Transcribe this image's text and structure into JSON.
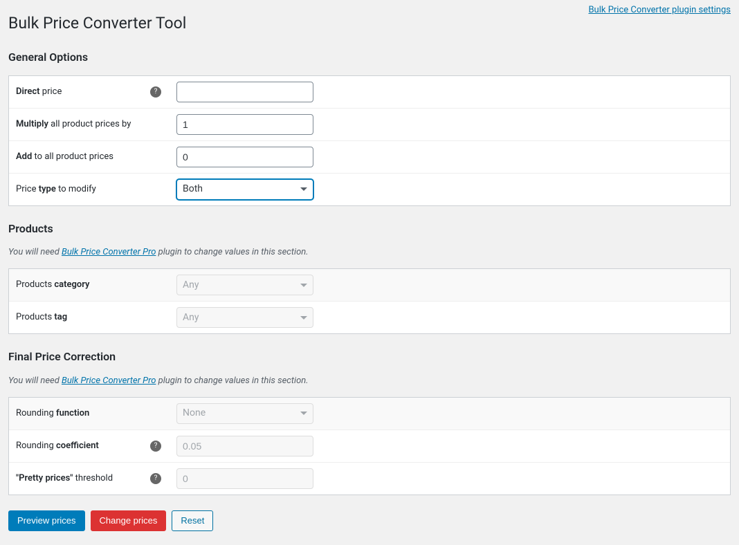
{
  "top_link": "Bulk Price Converter plugin settings",
  "page_title": "Bulk Price Converter Tool",
  "sections": {
    "general": {
      "title": "General Options",
      "rows": {
        "direct": {
          "label_strong": "Direct",
          "label_rest": " price",
          "value": ""
        },
        "multiply": {
          "label_strong": "Multiply",
          "label_rest": " all product prices by",
          "value": "1"
        },
        "add": {
          "label_strong": "Add",
          "label_rest": " to all product prices",
          "value": "0"
        },
        "pricetype": {
          "label_pre": "Price ",
          "label_strong": "type",
          "label_rest": " to modify",
          "value": "Both"
        }
      }
    },
    "products": {
      "title": "Products",
      "note_pre": "You will need ",
      "note_link": "Bulk Price Converter Pro",
      "note_post": " plugin to change values in this section.",
      "rows": {
        "category": {
          "label_pre": "Products ",
          "label_strong": "category",
          "value": "Any"
        },
        "tag": {
          "label_pre": "Products ",
          "label_strong": "tag",
          "value": "Any"
        }
      }
    },
    "final": {
      "title": "Final Price Correction",
      "note_pre": "You will need ",
      "note_link": "Bulk Price Converter Pro",
      "note_post": " plugin to change values in this section.",
      "rows": {
        "rounding_fn": {
          "label_pre": "Rounding ",
          "label_strong": "function",
          "value": "None"
        },
        "rounding_coef": {
          "label_pre": "Rounding ",
          "label_strong": "coefficient",
          "value": "0.05"
        },
        "pretty": {
          "label_strong": "\"Pretty prices\"",
          "label_rest": " threshold",
          "value": "0"
        }
      }
    }
  },
  "buttons": {
    "preview": "Preview prices",
    "change": "Change prices",
    "reset": "Reset"
  }
}
